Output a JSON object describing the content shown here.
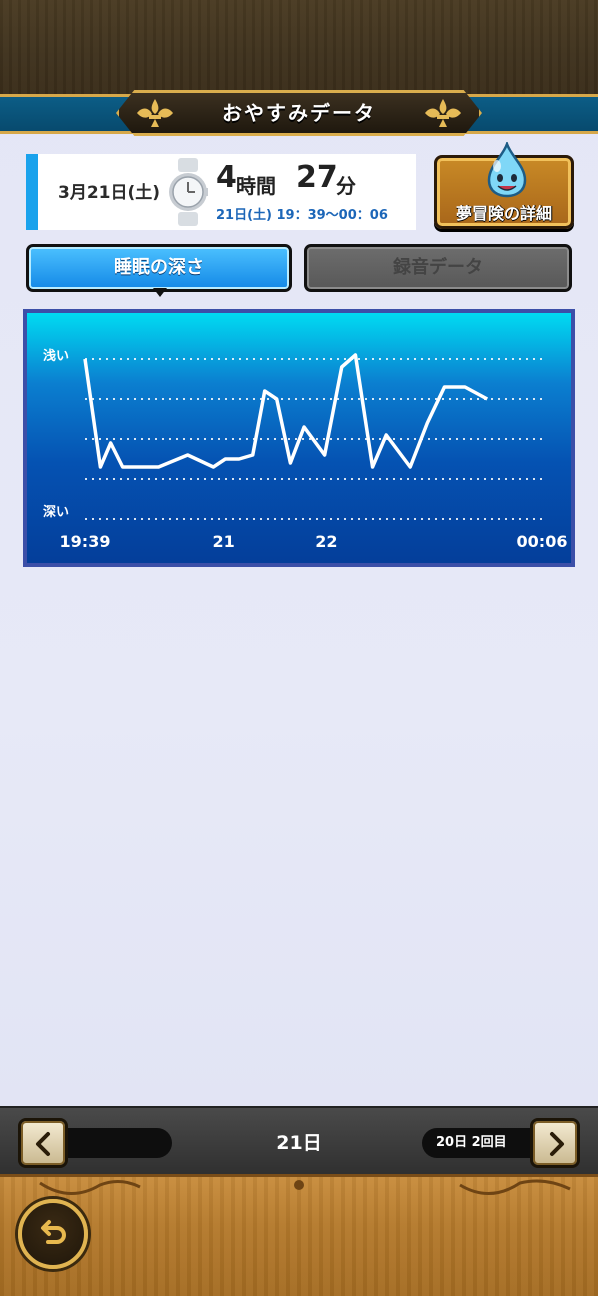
{
  "header": {
    "title": "おやすみデータ"
  },
  "summary": {
    "date": "3月21日(土)",
    "hours": "4",
    "hours_unit": "時間",
    "minutes": "27",
    "minutes_unit": "分",
    "range": "21日(土) 19：39～00：06"
  },
  "adventure_button": {
    "label": "夢冒険の詳細"
  },
  "tabs": [
    {
      "label": "睡眠の深さ",
      "active": true
    },
    {
      "label": "録音データ",
      "active": false
    }
  ],
  "chart_data": {
    "type": "line",
    "title": "",
    "y_top_label": "浅い",
    "y_bottom_label": "深い",
    "x_tick_labels": [
      "19:39",
      "21",
      "22",
      "00:06"
    ],
    "x_tick_positions_minutes": [
      0,
      81,
      141,
      267
    ],
    "x_range_minutes": [
      0,
      267
    ],
    "y_range": [
      0,
      4
    ],
    "series": [
      {
        "x_minutes": [
          0,
          9,
          15,
          22,
          30,
          43,
          60,
          75,
          82,
          90,
          98,
          105,
          112,
          120,
          128,
          140,
          150,
          158,
          168,
          176,
          190,
          200,
          210,
          222,
          235,
          246
        ],
        "y": [
          4.0,
          1.3,
          1.9,
          1.3,
          1.3,
          1.3,
          1.6,
          1.3,
          1.5,
          1.5,
          1.6,
          3.2,
          3.0,
          1.4,
          2.3,
          1.6,
          3.8,
          4.1,
          1.3,
          2.1,
          1.3,
          2.4,
          3.3,
          3.3,
          3.0,
          null
        ]
      }
    ],
    "grid": true,
    "line_color": "#ffffff",
    "grid_color": "#ffffff"
  },
  "bottom_nav": {
    "current_day": "21日",
    "next_label": "20日 2回目"
  },
  "icons": {
    "prev": "chevron-left-icon",
    "next": "chevron-right-icon",
    "back": "back-arrow-icon",
    "watch": "watch-icon",
    "slime": "slime-icon"
  },
  "colors": {
    "accent": "#1aa2ec",
    "header_blue": "#0c5d86",
    "gold": "#d9ad4d",
    "wood": "#b57a2c"
  }
}
